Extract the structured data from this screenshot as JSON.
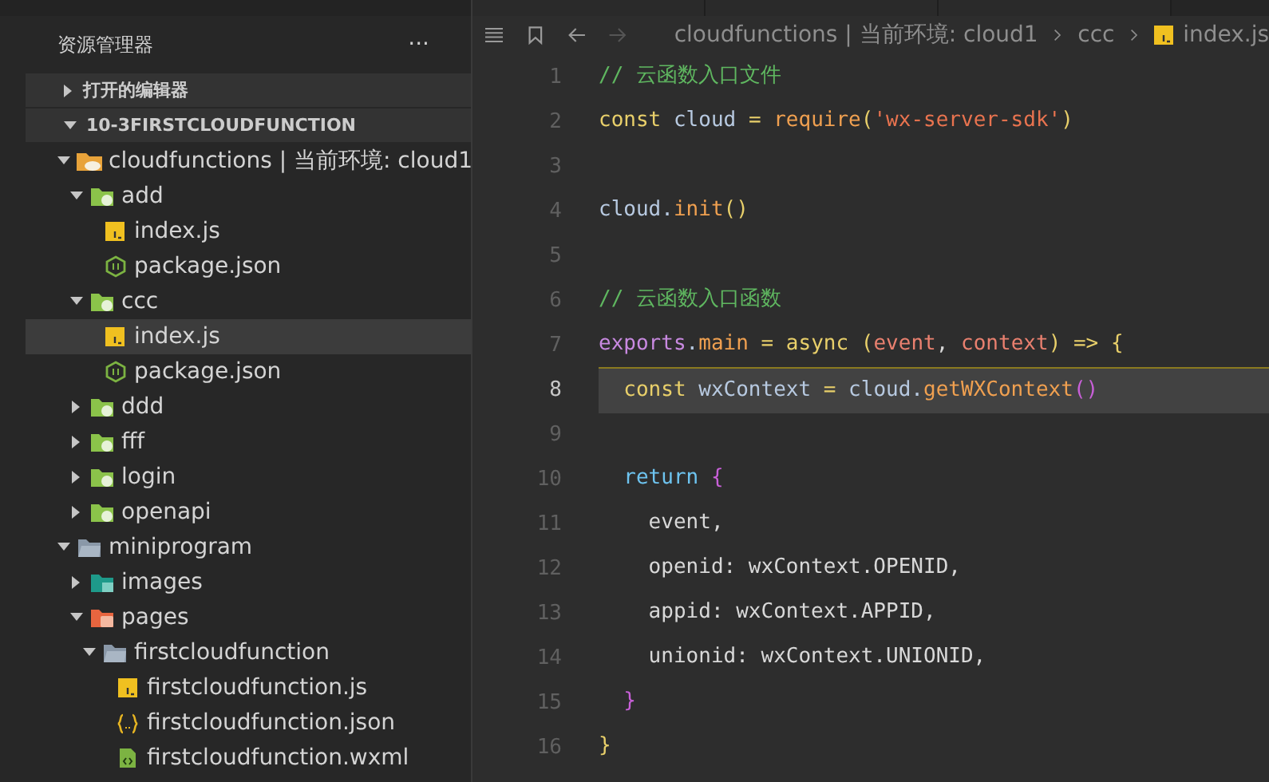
{
  "sidebar": {
    "title": "资源管理器",
    "more": "···",
    "sections": [
      {
        "label": "打开的编辑器",
        "expanded": false
      },
      {
        "label": "10-3FIRSTCLOUDFUNCTION",
        "expanded": true
      }
    ],
    "tree": [
      {
        "label": "cloudfunctions | 当前环境: cloud1",
        "kind": "folder-cloud",
        "expanded": true,
        "selected": false,
        "children": [
          {
            "label": "add",
            "kind": "folder-function",
            "expanded": true,
            "selected": false,
            "children": [
              {
                "label": "index.js",
                "kind": "js",
                "selected": false
              },
              {
                "label": "package.json",
                "kind": "node",
                "selected": false
              }
            ]
          },
          {
            "label": "ccc",
            "kind": "folder-function",
            "expanded": true,
            "selected": false,
            "children": [
              {
                "label": "index.js",
                "kind": "js",
                "selected": true
              },
              {
                "label": "package.json",
                "kind": "node",
                "selected": false
              }
            ]
          },
          {
            "label": "ddd",
            "kind": "folder-function",
            "expanded": false,
            "selected": false
          },
          {
            "label": "fff",
            "kind": "folder-function",
            "expanded": false,
            "selected": false
          },
          {
            "label": "login",
            "kind": "folder-function",
            "expanded": false,
            "selected": false
          },
          {
            "label": "openapi",
            "kind": "folder-function",
            "expanded": false,
            "selected": false
          }
        ]
      },
      {
        "label": "miniprogram",
        "kind": "folder-grey",
        "expanded": true,
        "selected": false,
        "children": [
          {
            "label": "images",
            "kind": "folder-images",
            "expanded": false,
            "selected": false
          },
          {
            "label": "pages",
            "kind": "folder-pages",
            "expanded": true,
            "selected": false,
            "children": [
              {
                "label": "firstcloudfunction",
                "kind": "folder-grey",
                "expanded": true,
                "selected": false,
                "children": [
                  {
                    "label": "firstcloudfunction.js",
                    "kind": "js",
                    "selected": false
                  },
                  {
                    "label": "firstcloudfunction.json",
                    "kind": "braces",
                    "selected": false
                  },
                  {
                    "label": "firstcloudfunction.wxml",
                    "kind": "wxml",
                    "selected": false
                  }
                ]
              }
            ]
          }
        ]
      }
    ]
  },
  "breadcrumb": [
    {
      "text": "cloudfunctions | 当前环境: cloud1",
      "kind": "folder"
    },
    {
      "text": "ccc",
      "kind": "folder"
    },
    {
      "text": "index.js",
      "kind": "js"
    }
  ],
  "code": [
    {
      "number": "1",
      "current": false,
      "tokens": [
        {
          "text": "// 云函数入口文件",
          "kind": "comment"
        }
      ]
    },
    {
      "number": "2",
      "current": false,
      "tokens": [
        {
          "text": "const",
          "kind": "keyword"
        },
        {
          "text": " cloud ",
          "kind": "variable"
        },
        {
          "text": "=",
          "kind": "operator"
        },
        {
          "text": " require",
          "kind": "function"
        },
        {
          "text": "(",
          "kind": "paren"
        },
        {
          "text": "'wx-server-sdk'",
          "kind": "string"
        },
        {
          "text": ")",
          "kind": "paren"
        }
      ]
    },
    {
      "number": "3",
      "current": false
    },
    {
      "number": "4",
      "current": false,
      "tokens": [
        {
          "text": "cloud.",
          "kind": "variable"
        },
        {
          "text": "init",
          "kind": "function"
        },
        {
          "text": "()",
          "kind": "paren"
        }
      ]
    },
    {
      "number": "5",
      "current": false
    },
    {
      "number": "6",
      "current": false,
      "tokens": [
        {
          "text": "// 云函数入口函数",
          "kind": "comment"
        }
      ]
    },
    {
      "number": "7",
      "current": false,
      "tokens": [
        {
          "text": "exports",
          "kind": "object"
        },
        {
          "text": ".",
          "kind": "variable"
        },
        {
          "text": "main",
          "kind": "function"
        },
        {
          "text": " = ",
          "kind": "operator"
        },
        {
          "text": "async",
          "kind": "keyword"
        },
        {
          "text": " (",
          "kind": "paren"
        },
        {
          "text": "event",
          "kind": "param"
        },
        {
          "text": ", ",
          "kind": "plain"
        },
        {
          "text": "context",
          "kind": "param"
        },
        {
          "text": ")",
          "kind": "paren"
        },
        {
          "text": " => ",
          "kind": "operator"
        },
        {
          "text": "{",
          "kind": "paren"
        }
      ]
    },
    {
      "number": "8",
      "current": true,
      "tokens": [
        {
          "text": "  const",
          "kind": "keyword"
        },
        {
          "text": " wxContext ",
          "kind": "variable"
        },
        {
          "text": "=",
          "kind": "operator"
        },
        {
          "text": " cloud.",
          "kind": "variable"
        },
        {
          "text": "getWXContext",
          "kind": "function"
        },
        {
          "text": "()",
          "kind": "bracket"
        }
      ]
    },
    {
      "number": "9",
      "current": false
    },
    {
      "number": "10",
      "current": false,
      "tokens": [
        {
          "text": "  return",
          "kind": "return"
        },
        {
          "text": " {",
          "kind": "bracket"
        }
      ]
    },
    {
      "number": "11",
      "current": false,
      "tokens": [
        {
          "text": "    event,",
          "kind": "plain"
        }
      ]
    },
    {
      "number": "12",
      "current": false,
      "tokens": [
        {
          "text": "    openid: wxContext.OPENID,",
          "kind": "plain"
        }
      ]
    },
    {
      "number": "13",
      "current": false,
      "tokens": [
        {
          "text": "    appid: wxContext.APPID,",
          "kind": "plain"
        }
      ]
    },
    {
      "number": "14",
      "current": false,
      "tokens": [
        {
          "text": "    unionid: wxContext.UNIONID,",
          "kind": "plain"
        }
      ]
    },
    {
      "number": "15",
      "current": false,
      "tokens": [
        {
          "text": "  }",
          "kind": "bracket"
        }
      ]
    },
    {
      "number": "16",
      "current": false,
      "tokens": [
        {
          "text": "}",
          "kind": "paren"
        }
      ]
    }
  ]
}
